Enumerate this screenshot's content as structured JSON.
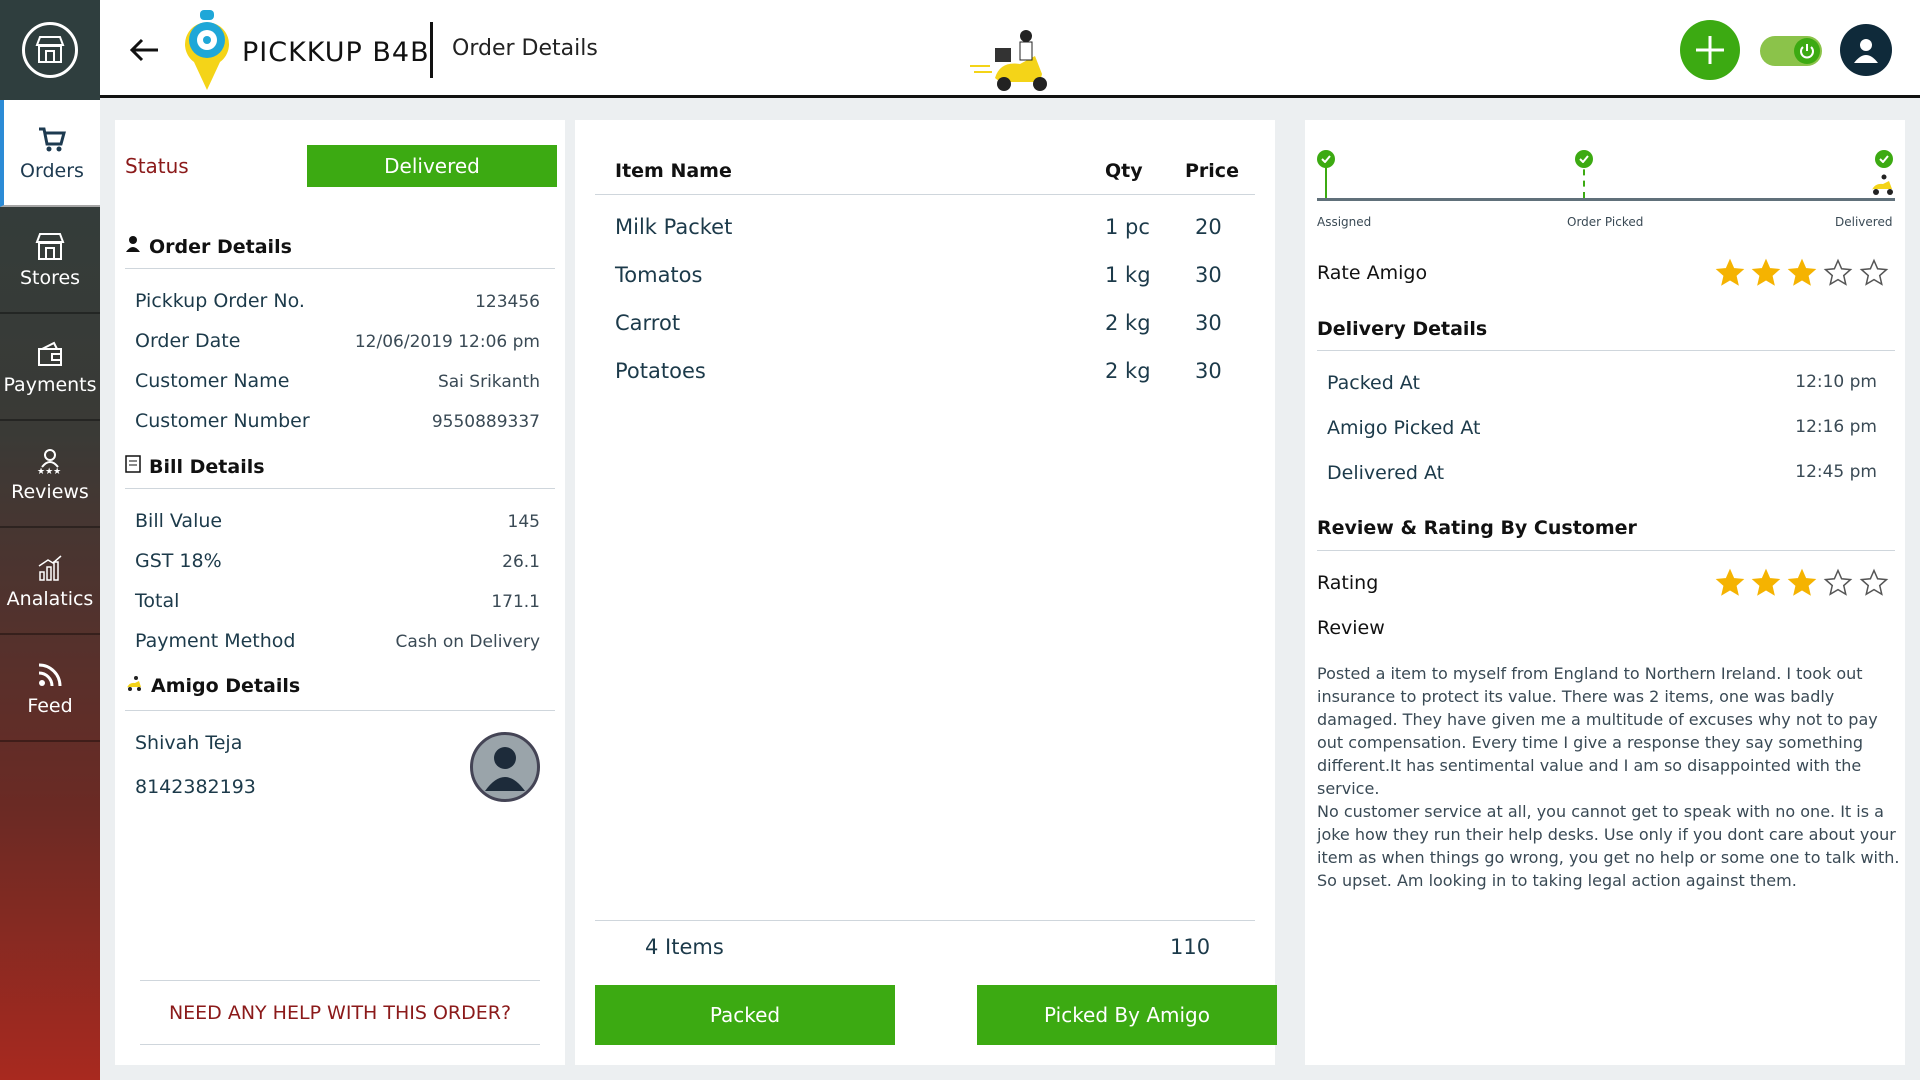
{
  "header": {
    "brand": "PICKKUP B4B",
    "page_title": "Order Details"
  },
  "sidebar": {
    "items": [
      {
        "label": "Orders",
        "icon": "cart-icon"
      },
      {
        "label": "Stores",
        "icon": "store-icon"
      },
      {
        "label": "Payments",
        "icon": "wallet-icon"
      },
      {
        "label": "Reviews",
        "icon": "reviews-icon"
      },
      {
        "label": "Analatics",
        "icon": "analytics-icon"
      },
      {
        "label": "Feed",
        "icon": "rss-icon"
      }
    ]
  },
  "left": {
    "status_label": "Status",
    "status_value": "Delivered",
    "order_details_title": "Order Details",
    "order": [
      {
        "k": "Pickkup Order No.",
        "v": "123456"
      },
      {
        "k": "Order Date",
        "v": "12/06/2019  12:06 pm"
      },
      {
        "k": "Customer Name",
        "v": "Sai Srikanth"
      },
      {
        "k": "Customer Number",
        "v": "9550889337"
      }
    ],
    "bill_details_title": "Bill Details",
    "bill": [
      {
        "k": "Bill Value",
        "v": "145"
      },
      {
        "k": "GST 18%",
        "v": "26.1"
      },
      {
        "k": "Total",
        "v": "171.1"
      },
      {
        "k": "Payment Method",
        "v": "Cash on Delivery"
      }
    ],
    "amigo_title": "Amigo Details",
    "amigo_name": "Shivah Teja",
    "amigo_phone": "8142382193",
    "help": "NEED ANY HELP WITH THIS ORDER?"
  },
  "middle": {
    "headers": {
      "item": "Item Name",
      "qty": "Qty",
      "price": "Price"
    },
    "rows": [
      {
        "item": "Milk Packet",
        "qty": "1 pc",
        "price": "20"
      },
      {
        "item": "Tomatos",
        "qty": "1 kg",
        "price": "30"
      },
      {
        "item": "Carrot",
        "qty": "2 kg",
        "price": "30"
      },
      {
        "item": "Potatoes",
        "qty": "2 kg",
        "price": "30"
      }
    ],
    "items_count": "4 Items",
    "total": "110",
    "packed_btn": "Packed",
    "picked_btn": "Picked By Amigo"
  },
  "right": {
    "track": [
      "Assigned",
      "Order Picked",
      "Delivered"
    ],
    "rate_amigo": "Rate Amigo",
    "rate_amigo_stars": 3,
    "delivery_details_title": "Delivery Details",
    "delivery": [
      {
        "k": "Packed At",
        "v": "12:10 pm"
      },
      {
        "k": "Amigo Picked At",
        "v": "12:16 pm"
      },
      {
        "k": "Delivered At",
        "v": "12:45 pm"
      }
    ],
    "review_rating_title": "Review & Rating By Customer",
    "rating_label": "Rating",
    "rating_stars": 3,
    "review_label": "Review",
    "review_text": "Posted a item to myself from England to Northern Ireland. I took out insurance to protect its value. There was 2 items, one was badly damaged. They have given me a multitude of excuses why not to pay out compensation. Every time I give a response they say something different.It has sentimental value and I am so disappointed with the service.\nNo customer service at all, you cannot get to speak with no one. It is a joke how they run their help desks. Use only if you dont care about your item as when things go wrong, you get no help or some one to talk with. So upset. Am looking in to taking legal action against them."
  },
  "colors": {
    "accent_green": "#3caa12",
    "status_red": "#8b1a1a",
    "star_gold": "#f5b301"
  }
}
